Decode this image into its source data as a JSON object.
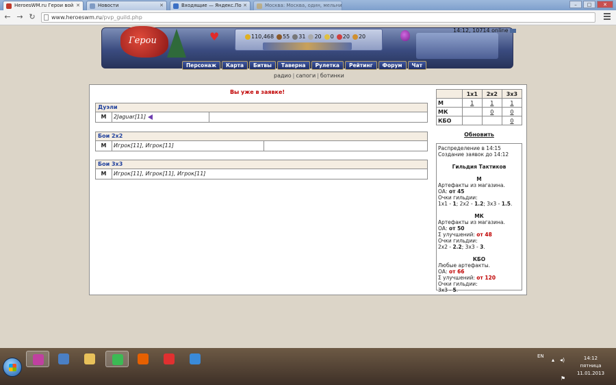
{
  "browser": {
    "tabs": [
      {
        "label": "HeroesWM.ru Герои вой",
        "active": true,
        "favicon_color": "#c0392b"
      },
      {
        "label": "Новости",
        "active": false,
        "favicon_color": "#7f9bc4"
      },
      {
        "label": "Входящие — Яндекс.По",
        "active": false,
        "favicon_color": "#3b6fc4"
      },
      {
        "label": "Москва: Москва, один, мельница и ...",
        "active": false,
        "favicon_color": "#e0b050"
      }
    ],
    "url_host": "www.heroeswm.ru",
    "url_path": "/pvp_guild.php",
    "back_icon": "arrow-left-icon",
    "forward_icon": "arrow-right-icon",
    "reload_icon": "reload-icon"
  },
  "header": {
    "logo_text": "Герои",
    "resources": [
      {
        "icon": "gold-icon",
        "value": "110,468",
        "color": "#e0b020"
      },
      {
        "icon": "wood-icon",
        "value": "55",
        "color": "#8b5a2b"
      },
      {
        "icon": "ore-icon",
        "value": "31",
        "color": "#777777"
      },
      {
        "icon": "mercury-icon",
        "value": "20",
        "color": "#aaaaaa"
      },
      {
        "icon": "sulfur-icon",
        "value": "0",
        "color": "#e0c040"
      },
      {
        "icon": "crystal-icon",
        "value": "20",
        "color": "#d04040"
      },
      {
        "icon": "gem-icon",
        "value": "20",
        "color": "#d09030"
      }
    ],
    "time_online": "14:12, 10714 online"
  },
  "nav": [
    "Персонаж",
    "Карта",
    "Битвы",
    "Таверна",
    "Рулетка",
    "Рейтинг",
    "Форум",
    "Чат"
  ],
  "sublinks": [
    "радио",
    "сапоги",
    "ботинки"
  ],
  "notice": "Вы уже в заявке!",
  "groups": [
    {
      "title": "Дуэли",
      "code": "М",
      "players": "2Jaguar[11]",
      "has_flag": true
    },
    {
      "title": "Бои 2x2",
      "code": "М",
      "players": "Игрок[11], Игрок[11]",
      "has_flag": false
    },
    {
      "title": "Бои 3x3",
      "code": "М",
      "players": "Игрок[11], Игрок[11], Игрок[11]",
      "has_flag": false
    }
  ],
  "stats": {
    "headers": [
      "",
      "1x1",
      "2x2",
      "3x3"
    ],
    "rows": [
      {
        "label": "М",
        "cells": [
          "1",
          "1",
          "1"
        ]
      },
      {
        "label": "МК",
        "cells": [
          "",
          "0",
          "0"
        ]
      },
      {
        "label": "КБО",
        "cells": [
          "",
          "",
          "0"
        ]
      }
    ]
  },
  "refresh_label": "Обновить",
  "info": {
    "distribution": "Распределение в 14:15",
    "creation": "Создание заявок до 14:12",
    "guild": "Гильдия Тактиков",
    "m": {
      "title": "М",
      "artifacts": "Артефакты из магазина.",
      "oa_label": "ОА:",
      "oa_value": "от 45",
      "points_label": "Очки гильдии:",
      "p1_label": "1x1 -",
      "p1": "1",
      "p2_label": "; 2x2 -",
      "p2": "1.2",
      "p3_label": "; 3x3 -",
      "p3": "1.5"
    },
    "mk": {
      "title": "МК",
      "artifacts": "Артефакты из магазина.",
      "oa_label": "ОА:",
      "oa_value": "от 50",
      "sum_label": "Σ улучшений:",
      "sum_value": "от 48",
      "points_label": "Очки гильдии:",
      "p2_label": "2x2 -",
      "p2": "2.2",
      "p3_label": "; 3x3 -",
      "p3": "3"
    },
    "kbo": {
      "title": "КБО",
      "artifacts": "Любые артефакты.",
      "oa_label": "ОА:",
      "oa_value": "от 66",
      "sum_label": "Σ улучшений:",
      "sum_value": "от 120",
      "points_label": "Очки гильдии:",
      "p3_label": "3x3 -",
      "p3": "5"
    }
  },
  "taskbar": {
    "items": [
      {
        "icon": "winrar-icon",
        "color": "#c040a0",
        "active": true
      },
      {
        "icon": "user-icon",
        "color": "#4a7fc4",
        "active": false
      },
      {
        "icon": "folder-icon",
        "color": "#e8c15a",
        "active": false
      },
      {
        "icon": "chrome-icon",
        "color": "#3cba54",
        "active": true
      },
      {
        "icon": "firefox-icon",
        "color": "#e66000",
        "active": false
      },
      {
        "icon": "yandex-icon",
        "color": "#e03030",
        "active": false
      },
      {
        "icon": "mail-icon",
        "color": "#3a8ad8",
        "active": false
      }
    ],
    "lang": "EN",
    "time": "14:12",
    "weekday": "пятница",
    "date": "11.01.2013"
  }
}
